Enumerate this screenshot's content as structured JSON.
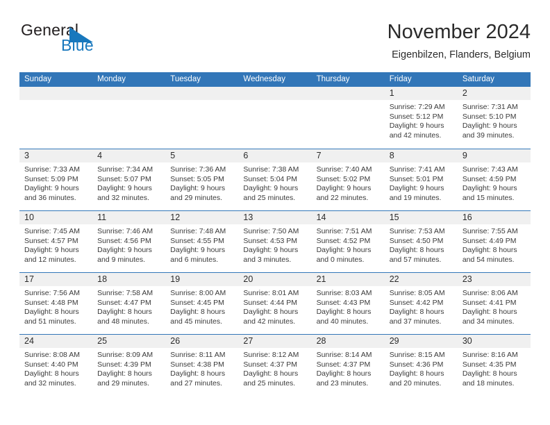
{
  "brand": {
    "word1": "General",
    "word2": "Blue",
    "triangle_color": "#1878bd",
    "icon": "triangle-logo-icon"
  },
  "header": {
    "month_title": "November 2024",
    "location": "Eigenbilzen, Flanders, Belgium"
  },
  "theme": {
    "header_blue": "#3276b8",
    "date_band_gray": "#f0f0f0",
    "text_dark": "#2b2b2b",
    "brand_blue": "#1878bd"
  },
  "weekdays": [
    "Sunday",
    "Monday",
    "Tuesday",
    "Wednesday",
    "Thursday",
    "Friday",
    "Saturday"
  ],
  "weeks": [
    [
      {
        "date": "",
        "lines": []
      },
      {
        "date": "",
        "lines": []
      },
      {
        "date": "",
        "lines": []
      },
      {
        "date": "",
        "lines": []
      },
      {
        "date": "",
        "lines": []
      },
      {
        "date": "1",
        "lines": [
          "Sunrise: 7:29 AM",
          "Sunset: 5:12 PM",
          "Daylight: 9 hours",
          "and 42 minutes."
        ]
      },
      {
        "date": "2",
        "lines": [
          "Sunrise: 7:31 AM",
          "Sunset: 5:10 PM",
          "Daylight: 9 hours",
          "and 39 minutes."
        ]
      }
    ],
    [
      {
        "date": "3",
        "lines": [
          "Sunrise: 7:33 AM",
          "Sunset: 5:09 PM",
          "Daylight: 9 hours",
          "and 36 minutes."
        ]
      },
      {
        "date": "4",
        "lines": [
          "Sunrise: 7:34 AM",
          "Sunset: 5:07 PM",
          "Daylight: 9 hours",
          "and 32 minutes."
        ]
      },
      {
        "date": "5",
        "lines": [
          "Sunrise: 7:36 AM",
          "Sunset: 5:05 PM",
          "Daylight: 9 hours",
          "and 29 minutes."
        ]
      },
      {
        "date": "6",
        "lines": [
          "Sunrise: 7:38 AM",
          "Sunset: 5:04 PM",
          "Daylight: 9 hours",
          "and 25 minutes."
        ]
      },
      {
        "date": "7",
        "lines": [
          "Sunrise: 7:40 AM",
          "Sunset: 5:02 PM",
          "Daylight: 9 hours",
          "and 22 minutes."
        ]
      },
      {
        "date": "8",
        "lines": [
          "Sunrise: 7:41 AM",
          "Sunset: 5:01 PM",
          "Daylight: 9 hours",
          "and 19 minutes."
        ]
      },
      {
        "date": "9",
        "lines": [
          "Sunrise: 7:43 AM",
          "Sunset: 4:59 PM",
          "Daylight: 9 hours",
          "and 15 minutes."
        ]
      }
    ],
    [
      {
        "date": "10",
        "lines": [
          "Sunrise: 7:45 AM",
          "Sunset: 4:57 PM",
          "Daylight: 9 hours",
          "and 12 minutes."
        ]
      },
      {
        "date": "11",
        "lines": [
          "Sunrise: 7:46 AM",
          "Sunset: 4:56 PM",
          "Daylight: 9 hours",
          "and 9 minutes."
        ]
      },
      {
        "date": "12",
        "lines": [
          "Sunrise: 7:48 AM",
          "Sunset: 4:55 PM",
          "Daylight: 9 hours",
          "and 6 minutes."
        ]
      },
      {
        "date": "13",
        "lines": [
          "Sunrise: 7:50 AM",
          "Sunset: 4:53 PM",
          "Daylight: 9 hours",
          "and 3 minutes."
        ]
      },
      {
        "date": "14",
        "lines": [
          "Sunrise: 7:51 AM",
          "Sunset: 4:52 PM",
          "Daylight: 9 hours",
          "and 0 minutes."
        ]
      },
      {
        "date": "15",
        "lines": [
          "Sunrise: 7:53 AM",
          "Sunset: 4:50 PM",
          "Daylight: 8 hours",
          "and 57 minutes."
        ]
      },
      {
        "date": "16",
        "lines": [
          "Sunrise: 7:55 AM",
          "Sunset: 4:49 PM",
          "Daylight: 8 hours",
          "and 54 minutes."
        ]
      }
    ],
    [
      {
        "date": "17",
        "lines": [
          "Sunrise: 7:56 AM",
          "Sunset: 4:48 PM",
          "Daylight: 8 hours",
          "and 51 minutes."
        ]
      },
      {
        "date": "18",
        "lines": [
          "Sunrise: 7:58 AM",
          "Sunset: 4:47 PM",
          "Daylight: 8 hours",
          "and 48 minutes."
        ]
      },
      {
        "date": "19",
        "lines": [
          "Sunrise: 8:00 AM",
          "Sunset: 4:45 PM",
          "Daylight: 8 hours",
          "and 45 minutes."
        ]
      },
      {
        "date": "20",
        "lines": [
          "Sunrise: 8:01 AM",
          "Sunset: 4:44 PM",
          "Daylight: 8 hours",
          "and 42 minutes."
        ]
      },
      {
        "date": "21",
        "lines": [
          "Sunrise: 8:03 AM",
          "Sunset: 4:43 PM",
          "Daylight: 8 hours",
          "and 40 minutes."
        ]
      },
      {
        "date": "22",
        "lines": [
          "Sunrise: 8:05 AM",
          "Sunset: 4:42 PM",
          "Daylight: 8 hours",
          "and 37 minutes."
        ]
      },
      {
        "date": "23",
        "lines": [
          "Sunrise: 8:06 AM",
          "Sunset: 4:41 PM",
          "Daylight: 8 hours",
          "and 34 minutes."
        ]
      }
    ],
    [
      {
        "date": "24",
        "lines": [
          "Sunrise: 8:08 AM",
          "Sunset: 4:40 PM",
          "Daylight: 8 hours",
          "and 32 minutes."
        ]
      },
      {
        "date": "25",
        "lines": [
          "Sunrise: 8:09 AM",
          "Sunset: 4:39 PM",
          "Daylight: 8 hours",
          "and 29 minutes."
        ]
      },
      {
        "date": "26",
        "lines": [
          "Sunrise: 8:11 AM",
          "Sunset: 4:38 PM",
          "Daylight: 8 hours",
          "and 27 minutes."
        ]
      },
      {
        "date": "27",
        "lines": [
          "Sunrise: 8:12 AM",
          "Sunset: 4:37 PM",
          "Daylight: 8 hours",
          "and 25 minutes."
        ]
      },
      {
        "date": "28",
        "lines": [
          "Sunrise: 8:14 AM",
          "Sunset: 4:37 PM",
          "Daylight: 8 hours",
          "and 23 minutes."
        ]
      },
      {
        "date": "29",
        "lines": [
          "Sunrise: 8:15 AM",
          "Sunset: 4:36 PM",
          "Daylight: 8 hours",
          "and 20 minutes."
        ]
      },
      {
        "date": "30",
        "lines": [
          "Sunrise: 8:16 AM",
          "Sunset: 4:35 PM",
          "Daylight: 8 hours",
          "and 18 minutes."
        ]
      }
    ]
  ]
}
